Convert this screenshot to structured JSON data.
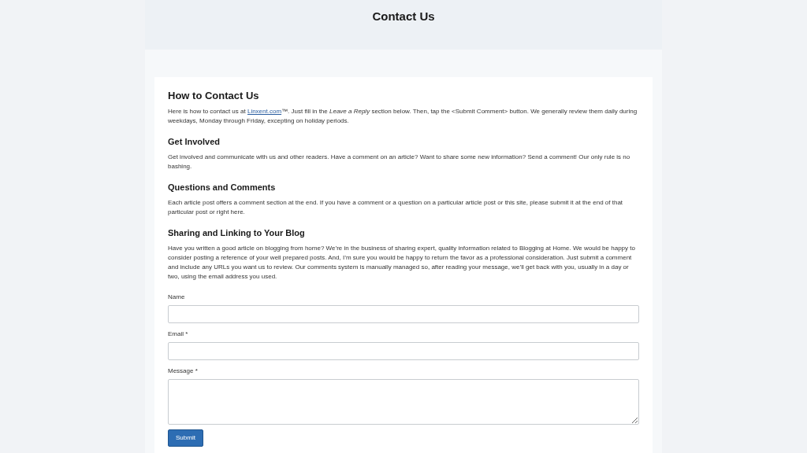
{
  "header": {
    "title": "Contact Us"
  },
  "sections": [
    {
      "heading": "How to Contact Us",
      "text_before_link": "Here is how to contact us at ",
      "link": "Linxent.com",
      "text_after_link": "™. Just fill in the *Leave a Reply* section below. Then, tap the <Submit Comment> button. We generally review them daily during weekdays, Monday through Friday, excepting on holiday periods."
    },
    {
      "heading": "Get Involved",
      "text_before_link": "Get involved and communicate with us and other readers. Have a comment on an article? Want to share some new information? Send a comment! Our only rule is no bashing."
    },
    {
      "heading": "Questions and Comments",
      "text_before_link": "Each article post offers a comment section at the end. If you have a comment or a question on a particular article post or this site, please submit it at the end of that particular post or right here."
    },
    {
      "heading": "Sharing and Linking to Your Blog",
      "text_before_link": "Have you written a good article on blogging from home? We’re in the business of sharing expert, quality information related to Blogging at Home. We would be happy to consider posting a reference of your well prepared posts. And, I’m sure you would be happy to return the favor as a professional consideration. Just submit a comment and include any URLs you want us to review. Our comments system is manually managed so, after reading your message, we’ll get back with you, usually in a day or two, using the email address you used."
    }
  ],
  "form": {
    "fields": [
      {
        "label": "Name",
        "kind": "input"
      },
      {
        "label": "Email *",
        "kind": "input"
      },
      {
        "label": "Message *",
        "kind": "textarea"
      }
    ],
    "submit": "Submit"
  }
}
